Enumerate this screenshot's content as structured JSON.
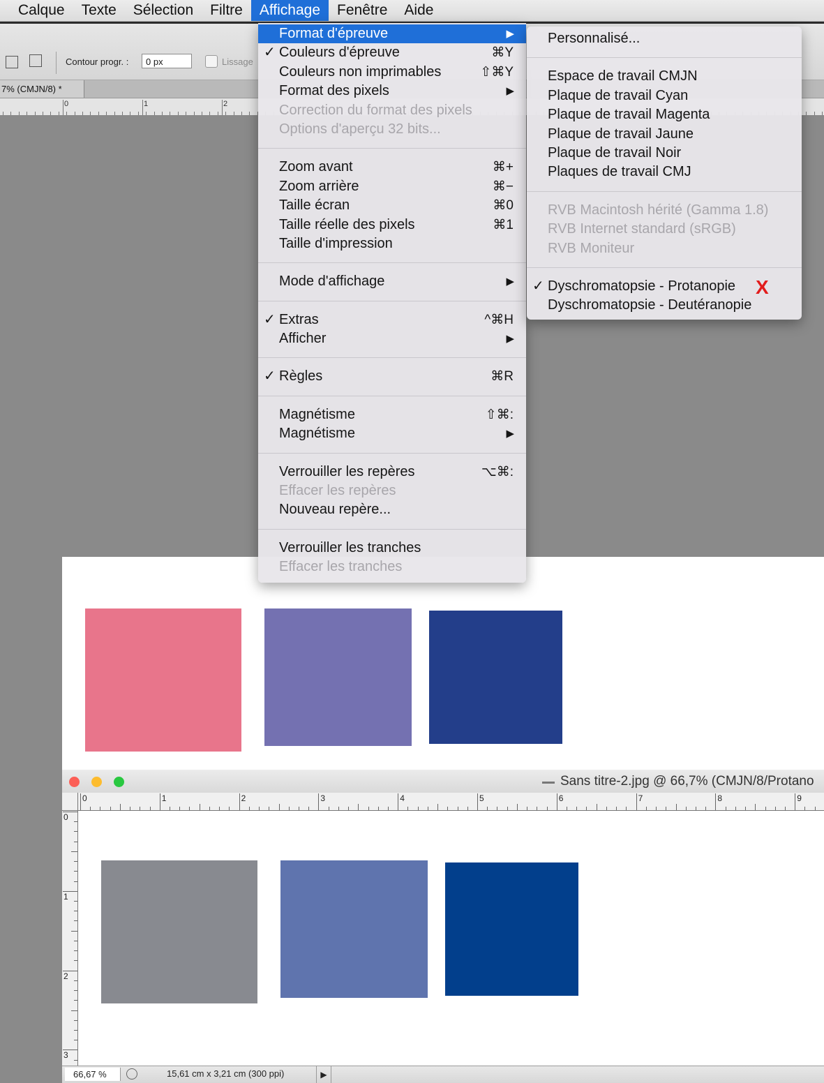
{
  "menubar": {
    "items": [
      "Calque",
      "Texte",
      "Sélection",
      "Filtre",
      "Affichage",
      "Fenêtre",
      "Aide"
    ],
    "active": "Affichage"
  },
  "options_bar": {
    "contour_label": "Contour progr. :",
    "contour_value": "0 px",
    "lissage_label": "Lissage"
  },
  "doc_tab_label": "7% (CMJN/8) *",
  "top_ruler_numbers": [
    "0",
    "1",
    "2"
  ],
  "affichage_menu": [
    {
      "label": "Format d'épreuve",
      "submenu": true,
      "highlight": true
    },
    {
      "label": "Couleurs d'épreuve",
      "check": true,
      "shortcut": "⌘Y"
    },
    {
      "label": "Couleurs non imprimables",
      "shortcut": "⇧⌘Y"
    },
    {
      "label": "Format des pixels",
      "submenu": true
    },
    {
      "label": "Correction du format des pixels",
      "disabled": true
    },
    {
      "label": "Options d'aperçu 32 bits...",
      "disabled": true
    },
    {
      "divider": true
    },
    {
      "label": "Zoom avant",
      "shortcut": "⌘+"
    },
    {
      "label": "Zoom arrière",
      "shortcut": "⌘−"
    },
    {
      "label": "Taille écran",
      "shortcut": "⌘0"
    },
    {
      "label": "Taille réelle des pixels",
      "shortcut": "⌘1"
    },
    {
      "label": "Taille d'impression"
    },
    {
      "divider": true
    },
    {
      "label": "Mode d'affichage",
      "submenu": true
    },
    {
      "divider": true
    },
    {
      "label": "Extras",
      "check": true,
      "shortcut": "^⌘H"
    },
    {
      "label": "Afficher",
      "submenu": true
    },
    {
      "divider": true
    },
    {
      "label": "Règles",
      "check": true,
      "shortcut": "⌘R"
    },
    {
      "divider": true
    },
    {
      "label": "Magnétisme",
      "shortcut": "⇧⌘:"
    },
    {
      "label": "Magnétisme",
      "submenu": true
    },
    {
      "divider": true
    },
    {
      "label": "Verrouiller les repères",
      "shortcut": "⌥⌘:"
    },
    {
      "label": "Effacer les repères",
      "disabled": true
    },
    {
      "label": "Nouveau repère..."
    },
    {
      "divider": true
    },
    {
      "label": "Verrouiller les tranches"
    },
    {
      "label": "Effacer les tranches",
      "disabled": true
    }
  ],
  "format_submenu": [
    {
      "label": "Personnalisé..."
    },
    {
      "divider": true
    },
    {
      "label": "Espace de travail CMJN"
    },
    {
      "label": "Plaque de travail Cyan"
    },
    {
      "label": "Plaque de travail Magenta"
    },
    {
      "label": "Plaque de travail Jaune"
    },
    {
      "label": "Plaque de travail Noir"
    },
    {
      "label": "Plaques de travail CMJ"
    },
    {
      "divider": true
    },
    {
      "label": "RVB Macintosh hérité (Gamma 1.8)",
      "disabled": true
    },
    {
      "label": "RVB Internet standard (sRGB)",
      "disabled": true
    },
    {
      "label": "RVB Moniteur",
      "disabled": true
    },
    {
      "divider": true
    },
    {
      "label": "Dyschromatopsie  - Protanopie",
      "check": true
    },
    {
      "label": "Dyschromatopsie - Deutéranopie"
    }
  ],
  "annotation_mark": "X",
  "swatches_original": [
    "#e8758b",
    "#7471b1",
    "#233e8a"
  ],
  "swatches_simulated": [
    "#888a90",
    "#5f74ae",
    "#023f8c"
  ],
  "doc_window": {
    "title": "Sans titre-2.jpg @ 66,7% (CMJN/8/Protano",
    "ruler_h_numbers": [
      "0",
      "1",
      "2",
      "3",
      "4",
      "5",
      "6",
      "7",
      "8",
      "9"
    ],
    "ruler_v_numbers": [
      "0",
      "1",
      "2",
      "3"
    ],
    "zoom": "66,67 %",
    "doc_size": "15,61 cm x 3,21 cm (300 ppi)"
  },
  "colors": {
    "highlight": "#1f6fd8",
    "annotation_red": "#e21c1c",
    "traffic_close": "#fc5f57",
    "traffic_min": "#fdbc2e",
    "traffic_max": "#29c840"
  }
}
